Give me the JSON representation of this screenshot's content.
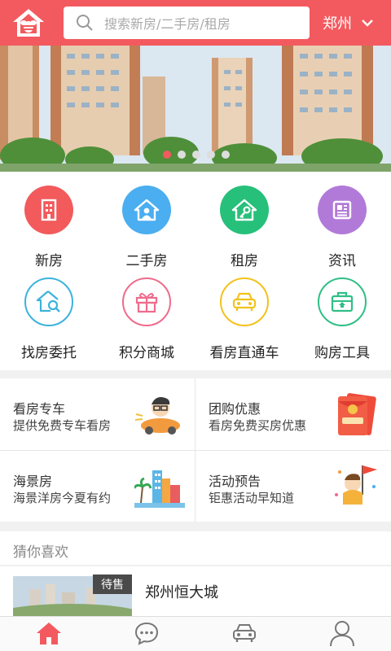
{
  "header": {
    "logo_icon": "bee-house-logo-icon",
    "search": {
      "placeholder": "搜索新房/二手房/租房",
      "icon": "search-icon"
    },
    "city": {
      "label": "郑州",
      "icon": "chevron-down-icon"
    }
  },
  "banner": {
    "slide_count": 5,
    "active_index": 0
  },
  "grid": [
    {
      "label": "新房",
      "icon": "building-icon",
      "color": "#f25a5c"
    },
    {
      "label": "二手房",
      "icon": "house-user-icon",
      "color": "#4aaef0"
    },
    {
      "label": "租房",
      "icon": "house-key-icon",
      "color": "#27c07a"
    },
    {
      "label": "资讯",
      "icon": "news-icon",
      "color": "#b17ad8"
    },
    {
      "label": "找房委托",
      "icon": "house-search-icon",
      "color": "#3cb3dc"
    },
    {
      "label": "积分商城",
      "icon": "gift-icon",
      "color": "#ef6b8c"
    },
    {
      "label": "看房直通车",
      "icon": "car-icon",
      "color": "#f3c21b"
    },
    {
      "label": "购房工具",
      "icon": "toolbox-icon",
      "color": "#2fbf86"
    }
  ],
  "promos": [
    {
      "title": "看房专车",
      "subtitle": "提供免费专车看房",
      "icon": "cartoon-car-icon"
    },
    {
      "title": "团购优惠",
      "subtitle": "看房免费买房优惠",
      "icon": "red-envelope-icon"
    },
    {
      "title": "海景房",
      "subtitle": "海景洋房今夏有约",
      "icon": "seaside-buildings-icon"
    },
    {
      "title": "活动预告",
      "subtitle": "钜惠活动早知道",
      "icon": "cartoon-flag-icon"
    }
  ],
  "recommend": {
    "heading": "猜你喜欢",
    "items": [
      {
        "name": "郑州恒大城",
        "status": "待售"
      }
    ]
  },
  "tabbar": [
    {
      "icon": "home-icon",
      "active": true,
      "color": "#f35a5f"
    },
    {
      "icon": "chat-icon",
      "active": false,
      "color": "#777777"
    },
    {
      "icon": "car-icon",
      "active": false,
      "color": "#777777"
    },
    {
      "icon": "user-icon",
      "active": false,
      "color": "#777777"
    }
  ],
  "colors": {
    "brand": "#f35a5f",
    "text_muted": "#888888"
  }
}
